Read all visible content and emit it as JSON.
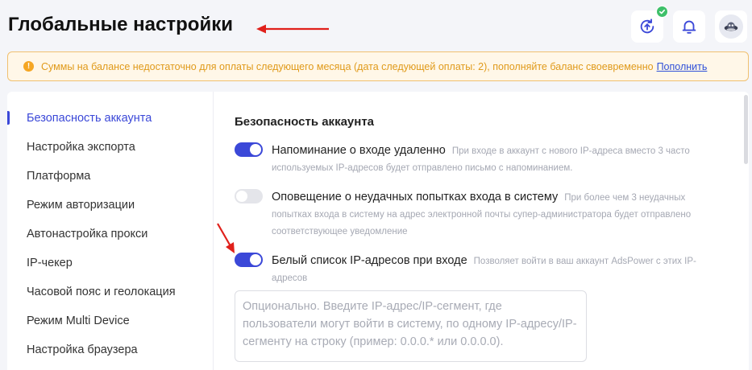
{
  "header": {
    "title": "Глобальные настройки"
  },
  "icons": {
    "sync": "sync-upload-icon",
    "check": "check-badge-icon",
    "bell": "bell-icon",
    "avatar": "avatar-icon",
    "warning": "warning-icon"
  },
  "warning": {
    "icon_glyph": "!",
    "text": "Суммы на балансе недостаточно для оплаты следующего месяца (дата следующей оплаты: 2), пополняйте баланс своевременно",
    "link": "Пополнить"
  },
  "sidebar": {
    "items": [
      {
        "label": "Безопасность аккаунта",
        "active": true
      },
      {
        "label": "Настройка экспорта"
      },
      {
        "label": "Платформа"
      },
      {
        "label": "Режим авторизации"
      },
      {
        "label": "Автонастройка прокси"
      },
      {
        "label": "IP-чекер"
      },
      {
        "label": "Часовой пояс и геолокация"
      },
      {
        "label": "Режим Multi Device"
      },
      {
        "label": "Настройка браузера"
      }
    ]
  },
  "main": {
    "section_title": "Безопасность аккаунта",
    "settings": [
      {
        "label": "Напоминание о входе удаленно",
        "description": "При входе в аккаунт с нового IP-адреса вместо 3 часто используемых IP-адресов будет отправлено письмо с напоминанием.",
        "enabled": true
      },
      {
        "label": "Оповещение о неудачных попытках входа в систему",
        "description": "При более чем 3 неудачных попытках входа в систему на адрес электронной почты супер-администратора будет отправлено соответствующее уведомление",
        "enabled": false
      },
      {
        "label": "Белый список IP-адресов при входе",
        "description": "Позволяет войти в ваш аккаунт AdsPower с этих IP-адресов",
        "enabled": true
      }
    ],
    "whitelist_placeholder": "Опционально. Введите IP-адрес/IP-сегмент, где пользователи могут войти в систему, по одному IP-адресу/IP-сегменту на строку (пример: 0.0.0.* или 0.0.0.0)."
  },
  "colors": {
    "accent": "#3b48d8",
    "annotation_arrow": "#e0201b",
    "warning_text": "#e09a1a",
    "warning_border": "#f0c070",
    "success": "#3ec06a"
  }
}
